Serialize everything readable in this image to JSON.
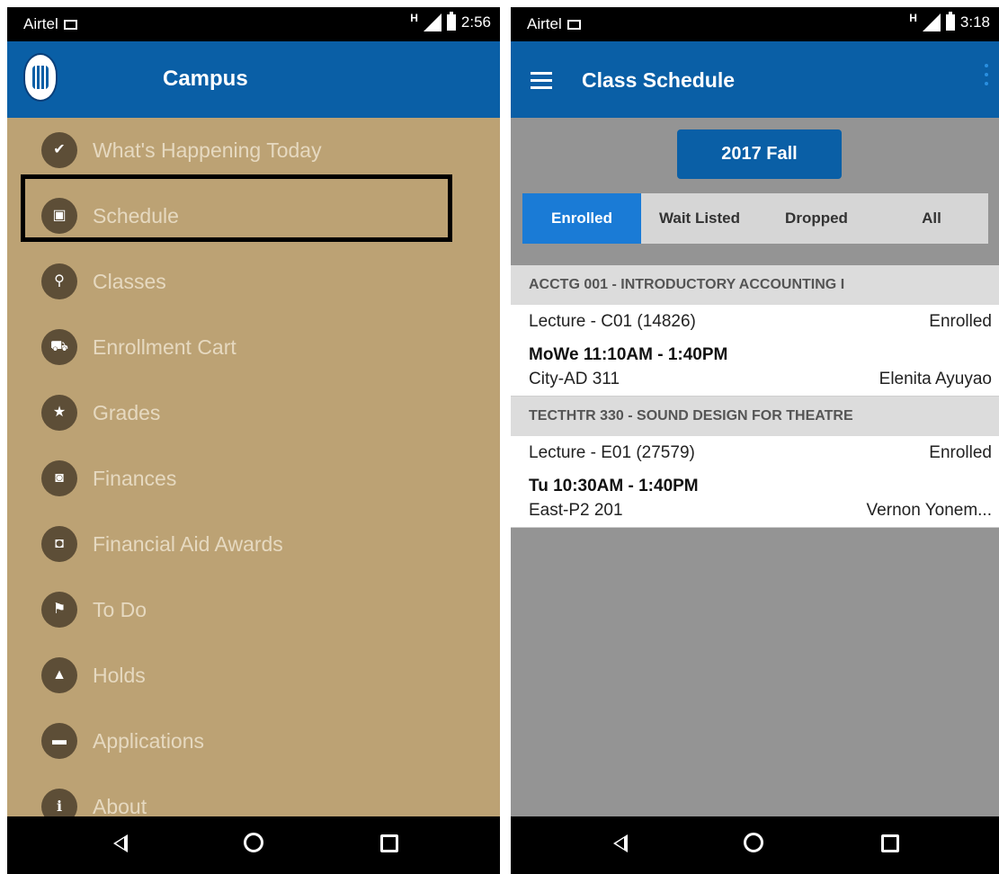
{
  "left": {
    "status": {
      "carrier": "Airtel",
      "network": "H",
      "time": "2:56"
    },
    "appbar": {
      "title": "Campus"
    },
    "menu": [
      {
        "label": "What's Happening Today",
        "icon": "calendar-check-icon",
        "glyph": "✔"
      },
      {
        "label": "Schedule",
        "icon": "calendar-icon",
        "glyph": "▣"
      },
      {
        "label": "Classes",
        "icon": "search-icon",
        "glyph": "⚲"
      },
      {
        "label": "Enrollment Cart",
        "icon": "cart-icon",
        "glyph": "⛟"
      },
      {
        "label": "Grades",
        "icon": "star-icon",
        "glyph": "★"
      },
      {
        "label": "Finances",
        "icon": "wallet-icon",
        "glyph": "◙"
      },
      {
        "label": "Financial Aid Awards",
        "icon": "briefcase-icon",
        "glyph": "◘"
      },
      {
        "label": "To Do",
        "icon": "flag-icon",
        "glyph": "⚑"
      },
      {
        "label": "Holds",
        "icon": "warning-icon",
        "glyph": "▲"
      },
      {
        "label": "Applications",
        "icon": "chat-icon",
        "glyph": "▬"
      },
      {
        "label": "About",
        "icon": "info-icon",
        "glyph": "i"
      }
    ]
  },
  "right": {
    "status": {
      "carrier": "Airtel",
      "network": "H",
      "time": "3:18"
    },
    "appbar": {
      "title": "Class Schedule"
    },
    "term": "2017 Fall",
    "tabs": [
      "Enrolled",
      "Wait Listed",
      "Dropped",
      "All"
    ],
    "classes": [
      {
        "course": "ACCTG 001 - INTRODUCTORY ACCOUNTING I",
        "component": "Lecture - C01 (14826)",
        "status": "Enrolled",
        "time": "MoWe 11:10AM - 1:40PM",
        "room": "City-AD 311",
        "instructor": "Elenita Ayuyao"
      },
      {
        "course": "TECTHTR 330 - SOUND DESIGN FOR THEATRE",
        "component": "Lecture - E01 (27579)",
        "status": "Enrolled",
        "time": "Tu 10:30AM - 1:40PM",
        "room": "East-P2 201",
        "instructor": "Vernon Yonem..."
      }
    ]
  },
  "colors": {
    "appbar": "#0a5fa6",
    "drawer": "#bca274",
    "icon_circle": "#5d4e37",
    "tab_active": "#1a7bd6",
    "content_bg": "#949494"
  }
}
